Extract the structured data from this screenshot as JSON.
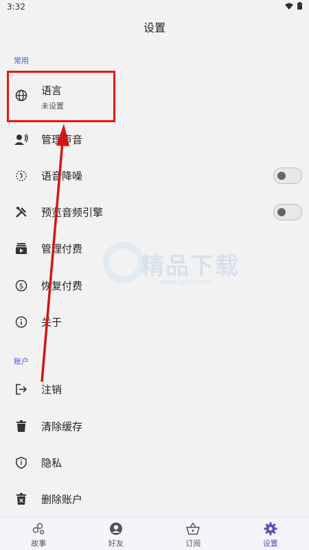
{
  "status": {
    "time": "3:32"
  },
  "header": {
    "title": "设置"
  },
  "sections": {
    "common": "常用",
    "account": "账户"
  },
  "rows": {
    "language": {
      "label": "语言",
      "sub": "未设置"
    },
    "voice": {
      "label": "管理声音"
    },
    "noise": {
      "label": "语音降噪",
      "toggle": false
    },
    "preview": {
      "label": "预览音频引擎",
      "toggle": false
    },
    "payments": {
      "label": "管理付费"
    },
    "restore": {
      "label": "恢复付费"
    },
    "about": {
      "label": "关于"
    },
    "logout": {
      "label": "注销"
    },
    "cache": {
      "label": "清除缓存"
    },
    "privacy": {
      "label": "隐私"
    },
    "delete": {
      "label": "删除账户"
    }
  },
  "watermark": {
    "text": "精品下载",
    "url": "www.jpjv.com"
  },
  "nav": [
    {
      "label": "故事",
      "icon": "bubbles-icon"
    },
    {
      "label": "好友",
      "icon": "user-circle-icon"
    },
    {
      "label": "订阅",
      "icon": "basket-icon"
    },
    {
      "label": "设置",
      "icon": "gear-icon",
      "active": true
    }
  ],
  "colors": {
    "accent": "#4a5bd6",
    "highlight": "#e11111",
    "nav_active": "#5d4db3"
  }
}
